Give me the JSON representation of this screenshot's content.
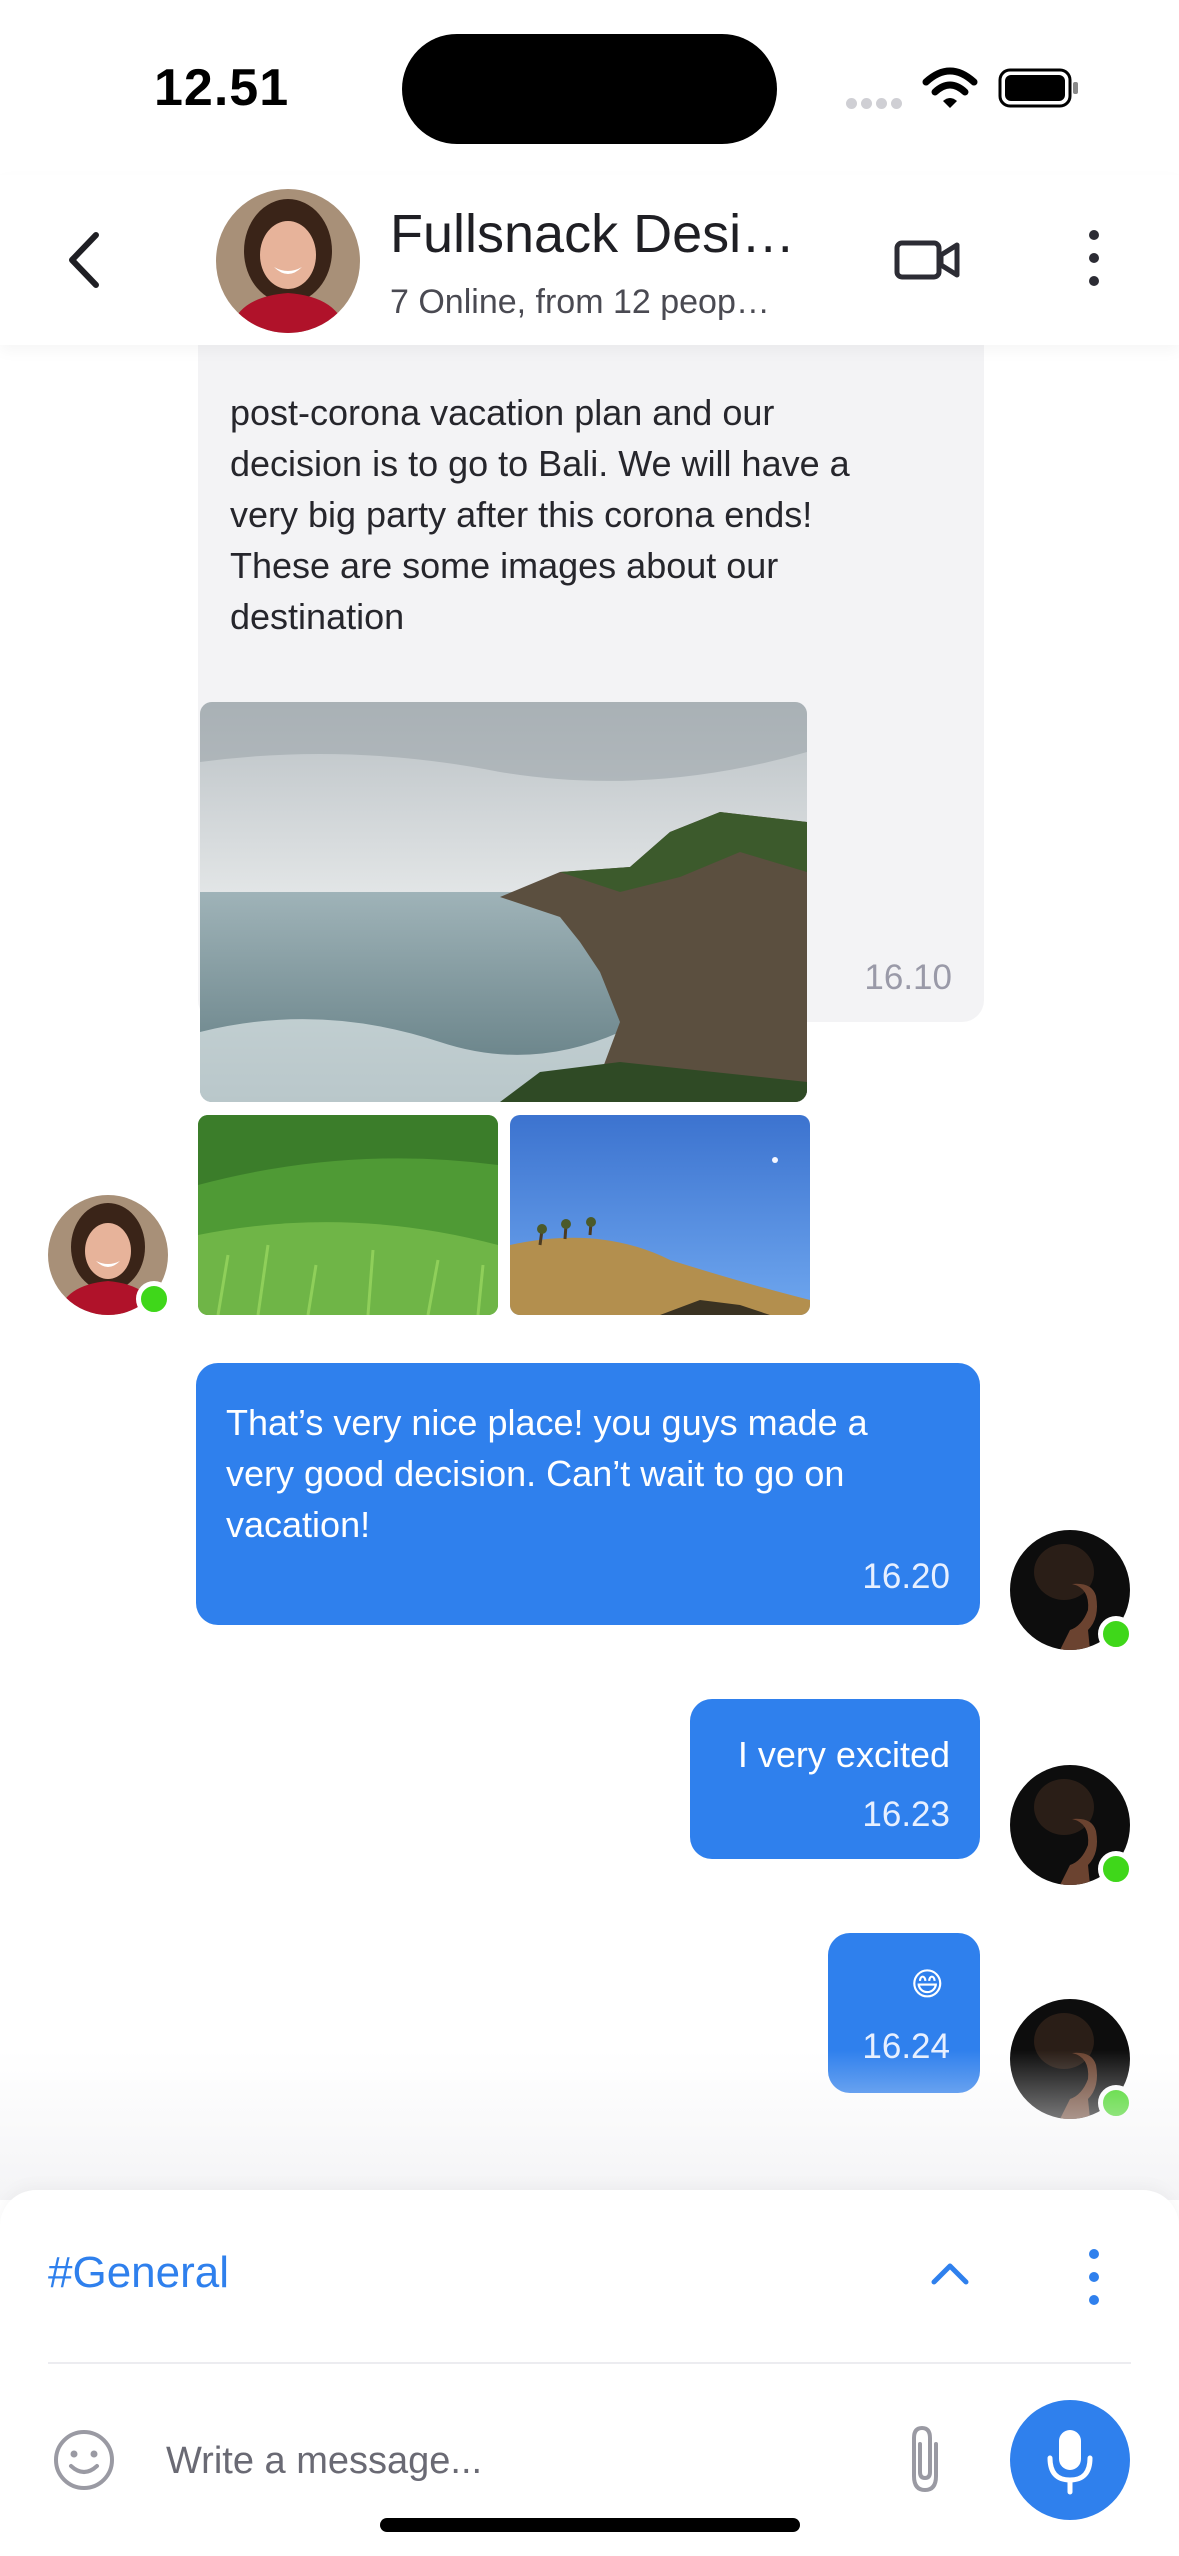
{
  "status_bar": {
    "time": "12.51"
  },
  "header": {
    "title": "Fullsnack Desi…",
    "subtitle": "7 Online, from 12 peop…"
  },
  "messages": [
    {
      "direction": "incoming",
      "text": "post-corona vacation plan and our\ndecision is to go to Bali. We will have a\nvery big party after this corona ends!\nThese are some images about our\ndestination",
      "time": "16.10"
    },
    {
      "direction": "outgoing",
      "text": "That’s very nice place! you guys made a\nvery good decision. Can’t wait to go on\nvacation!",
      "time": "16.20"
    },
    {
      "direction": "outgoing",
      "text": "I very excited",
      "time": "16.23"
    },
    {
      "direction": "outgoing",
      "text": "😄",
      "time": "16.24"
    }
  ],
  "composer": {
    "channel": "#General",
    "placeholder": "Write a message..."
  },
  "colors": {
    "accent": "#2f80ed",
    "online": "#3fd71a",
    "incoming_bubble": "#f3f3f5"
  },
  "icons": [
    "back-icon",
    "video-call-icon",
    "more-vertical-icon",
    "chevron-up-icon",
    "emoji-icon",
    "paperclip-icon",
    "microphone-icon",
    "wifi-icon",
    "battery-icon"
  ]
}
